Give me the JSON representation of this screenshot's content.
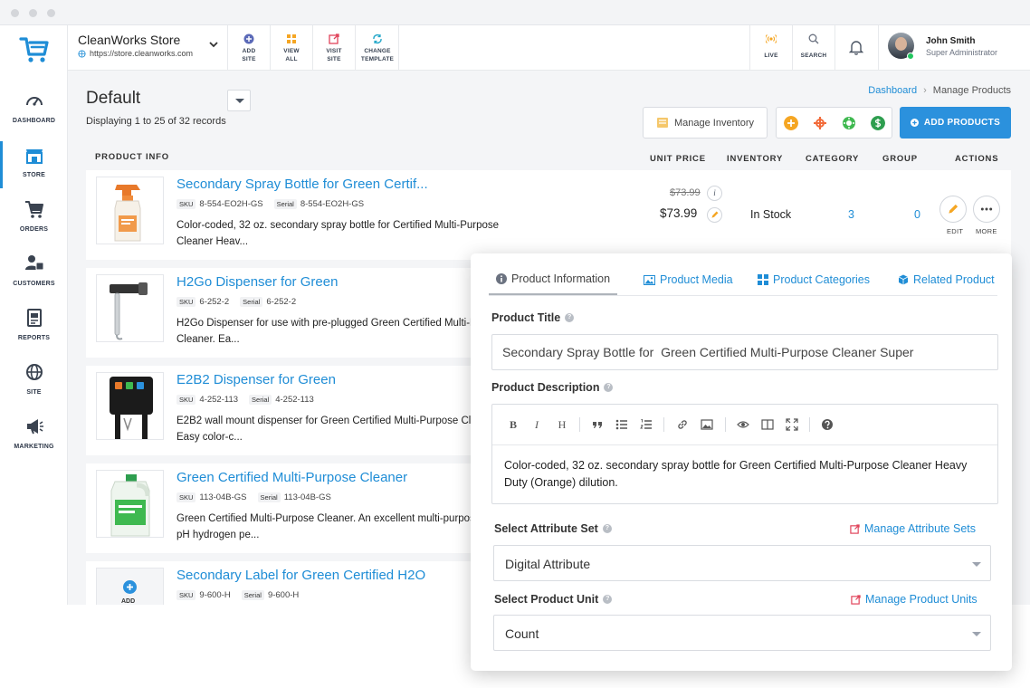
{
  "store": {
    "name": "CleanWorks Store",
    "url": "https://store.cleanworks.com"
  },
  "topbar": {
    "add_site": "ADD SITE",
    "view_all": "VIEW ALL",
    "visit_site": "VISIT SITE",
    "change_template": "CHANGE TEMPLATE",
    "live": "LIVE",
    "search": "SEARCH"
  },
  "user": {
    "name": "John Smith",
    "role": "Super Administrator"
  },
  "sidebar": {
    "items": [
      {
        "label": "DASHBOARD",
        "icon": "speedometer-icon"
      },
      {
        "label": "STORE",
        "icon": "store-icon"
      },
      {
        "label": "ORDERS",
        "icon": "cart-icon"
      },
      {
        "label": "CUSTOMERS",
        "icon": "customers-icon"
      },
      {
        "label": "REPORTS",
        "icon": "report-icon"
      },
      {
        "label": "SITE",
        "icon": "globe-icon"
      },
      {
        "label": "MARKETING",
        "icon": "megaphone-icon"
      }
    ]
  },
  "page": {
    "view_name": "Default",
    "records": "Displaying 1 to 25 of 32 records",
    "breadcrumb": [
      "Dashboard",
      "Manage Products"
    ],
    "manage_inventory": "Manage Inventory",
    "add_products": "ADD PRODUCTS"
  },
  "columns": {
    "product_info": "PRODUCT INFO",
    "unit_price": "UNIT PRICE",
    "inventory": "INVENTORY",
    "category": "CATEGORY",
    "group": "GROUP",
    "actions": "ACTIONS"
  },
  "actions": {
    "edit": "EDIT",
    "more": "MORE"
  },
  "products": [
    {
      "title": "Secondary Spray Bottle for Green Certif...",
      "sku_label": "SKU",
      "sku": "8-554-EO2H-GS",
      "serial_label": "Serial",
      "serial": "8-554-EO2H-GS",
      "desc": "Color-coded, 32 oz. secondary spray bottle for Certified Multi-Purpose Cleaner Heav...",
      "old_price": "$73.99",
      "price": "$73.99",
      "inventory": "In Stock",
      "category": "3",
      "group": "0"
    },
    {
      "title": "H2Go Dispenser for Green",
      "sku_label": "SKU",
      "sku": "6-252-2",
      "serial_label": "Serial",
      "serial": "6-252-2",
      "desc": "H2Go Dispenser for use with pre-plugged Green Certified Multi-Purpose Cleaner. Ea..."
    },
    {
      "title": "E2B2 Dispenser for Green",
      "sku_label": "SKU",
      "sku": "4-252-113",
      "serial_label": "Serial",
      "serial": "4-252-113",
      "desc": "E2B2 wall mount dispenser for Green Certified Multi-Purpose Cleaner. Easy color-c..."
    },
    {
      "title": "Green Certified Multi-Purpose Cleaner",
      "sku_label": "SKU",
      "sku": "113-04B-GS",
      "serial_label": "Serial",
      "serial": "113-04B-GS",
      "desc": "Green Certified Multi-Purpose Cleaner. An excellent multi-purpose neutral pH hydrogen pe..."
    },
    {
      "title": "Secondary Label for Green Certified H2O",
      "sku_label": "SKU",
      "sku": "9-600-H",
      "serial_label": "Serial",
      "serial": "9-600-H",
      "add_label": "ADD"
    }
  ],
  "panel": {
    "tabs": [
      "Product Information",
      "Product Media",
      "Product Categories",
      "Related Product"
    ],
    "title_label": "Product Title",
    "title_value": "Secondary Spray Bottle for  Green Certified Multi-Purpose Cleaner Super",
    "desc_label": "Product Description",
    "desc_value": "Color-coded, 32 oz. secondary spray bottle for Green Certified Multi-Purpose Cleaner Heavy Duty (Orange) dilution.",
    "attr_label": "Select Attribute Set",
    "attr_link": "Manage Attribute Sets",
    "attr_value": "Digital Attribute",
    "unit_label": "Select Product Unit",
    "unit_link": "Manage Product Units",
    "unit_value": "Count"
  },
  "colors": {
    "accent": "#1f8dd6",
    "primary_button": "#2b91dd",
    "orange": "#f5a623",
    "green": "#3fb950",
    "online": "#22c55e"
  }
}
